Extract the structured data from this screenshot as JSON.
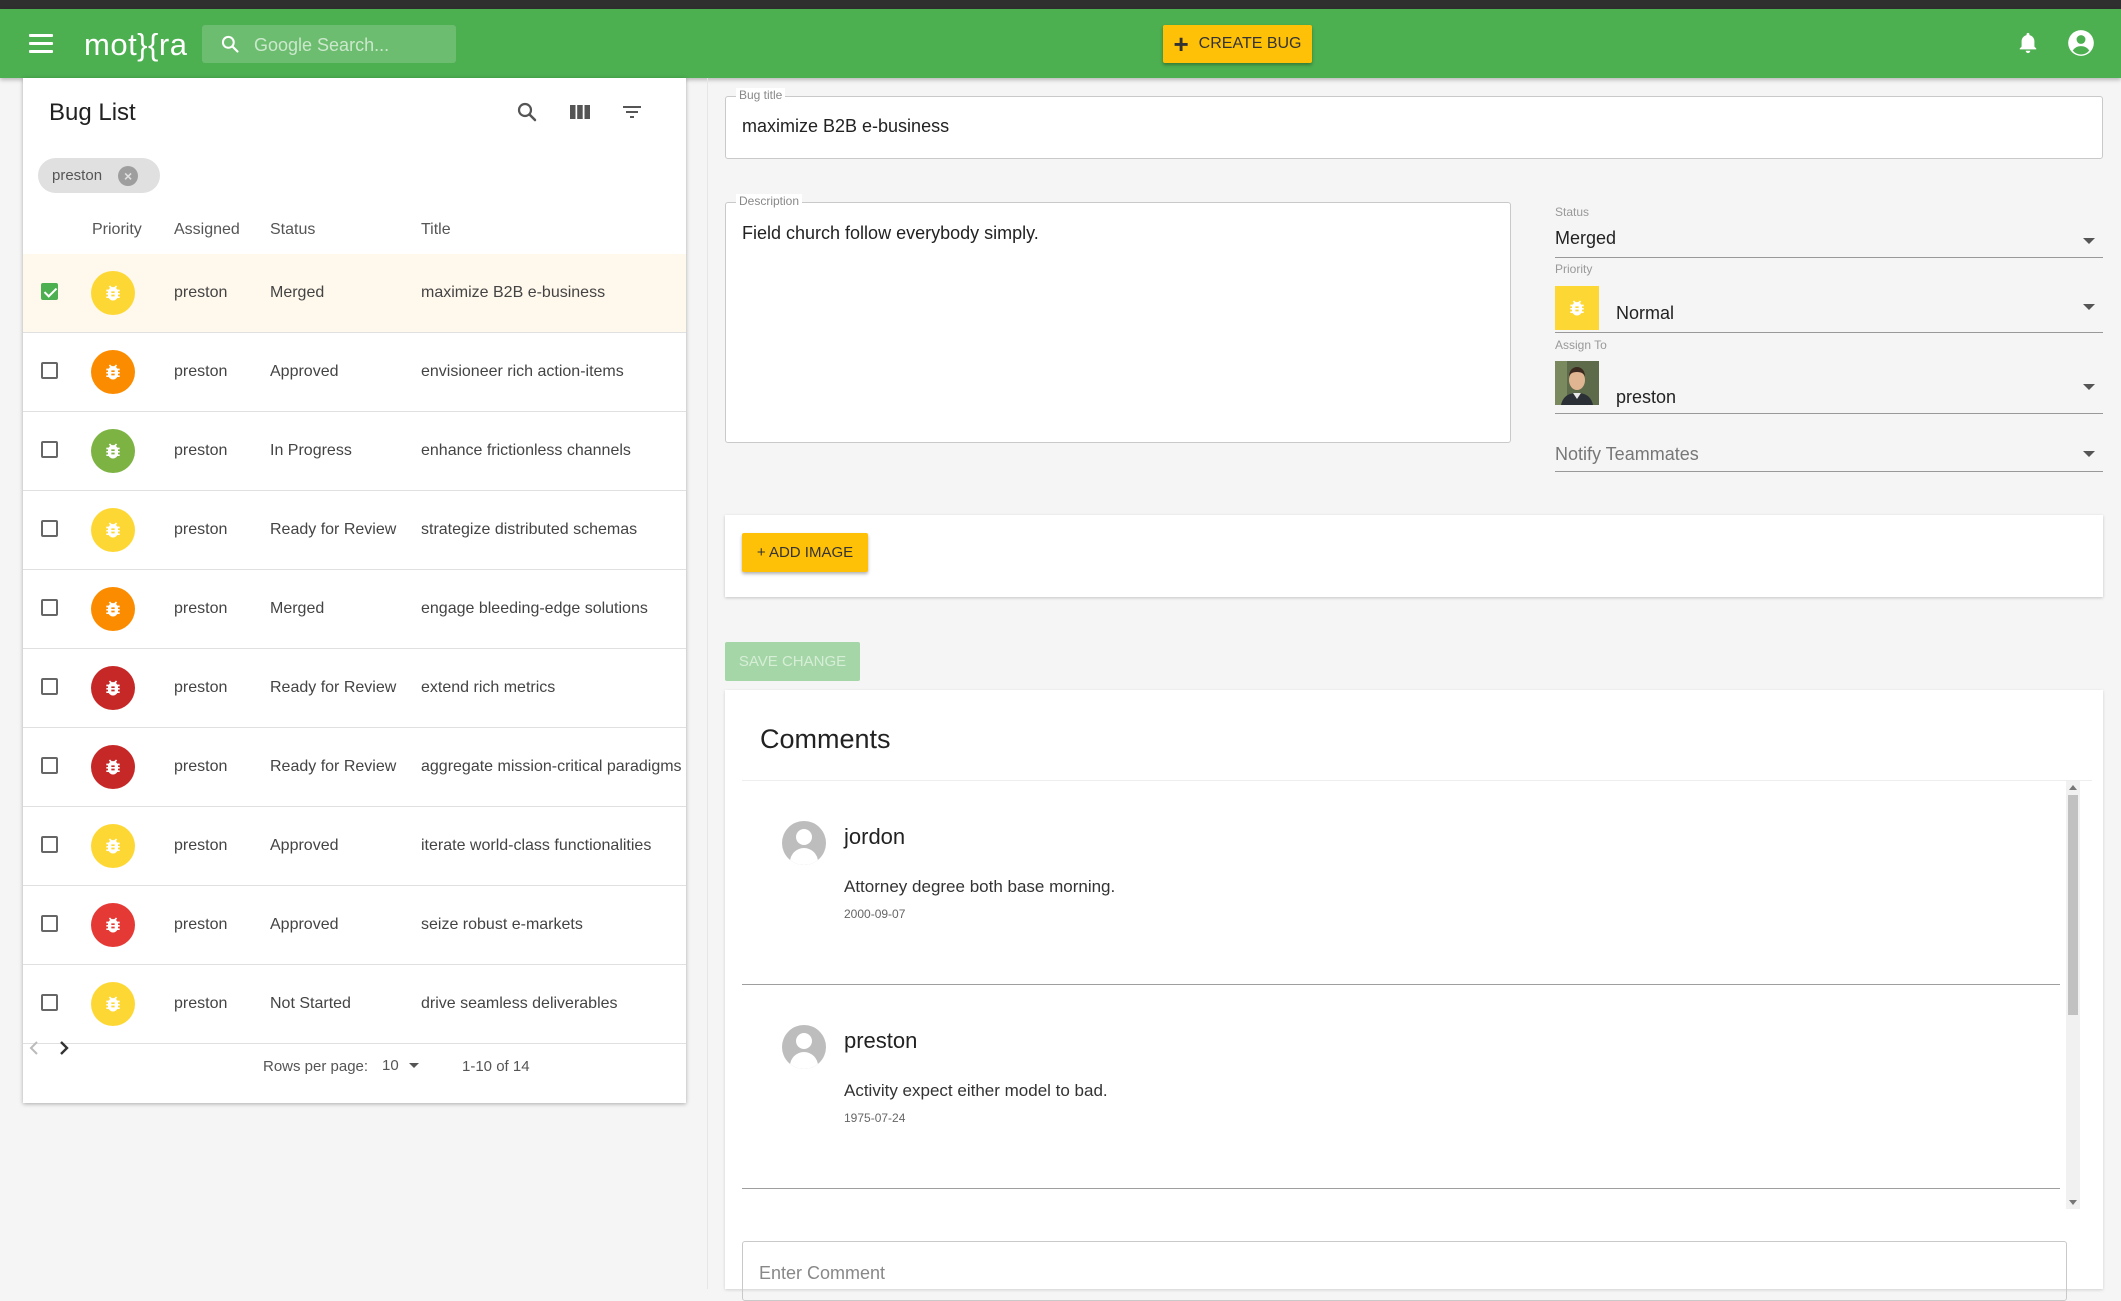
{
  "app": {
    "brand": "mot}{ra",
    "search_placeholder": "Google Search...",
    "create_bug_label": "CREATE BUG"
  },
  "colors": {
    "appbar": "#4caf50",
    "accent": "#ffc107",
    "priority_critical": "#c62828",
    "priority_high": "#e53935",
    "priority_medium": "#fb8c00",
    "priority_normal": "#fdd835",
    "priority_low": "#7cb342"
  },
  "bug_list": {
    "title": "Bug List",
    "filter_chip": "preston",
    "columns": [
      "Priority",
      "Assigned",
      "Status",
      "Title"
    ],
    "rows": [
      {
        "priority_color": "#fdd835",
        "assigned": "preston",
        "status": "Merged",
        "title": "maximize B2B e-business",
        "selected": true
      },
      {
        "priority_color": "#fb8c00",
        "assigned": "preston",
        "status": "Approved",
        "title": "envisioneer rich action-items",
        "selected": false
      },
      {
        "priority_color": "#7cb342",
        "assigned": "preston",
        "status": "In Progress",
        "title": "enhance frictionless channels",
        "selected": false
      },
      {
        "priority_color": "#fdd835",
        "assigned": "preston",
        "status": "Ready for Review",
        "title": "strategize distributed schemas",
        "selected": false
      },
      {
        "priority_color": "#fb8c00",
        "assigned": "preston",
        "status": "Merged",
        "title": "engage bleeding-edge solutions",
        "selected": false
      },
      {
        "priority_color": "#c62828",
        "assigned": "preston",
        "status": "Ready for Review",
        "title": "extend rich metrics",
        "selected": false
      },
      {
        "priority_color": "#c62828",
        "assigned": "preston",
        "status": "Ready for Review",
        "title": "aggregate mission-critical paradigms",
        "selected": false
      },
      {
        "priority_color": "#fdd835",
        "assigned": "preston",
        "status": "Approved",
        "title": "iterate world-class functionalities",
        "selected": false
      },
      {
        "priority_color": "#e53935",
        "assigned": "preston",
        "status": "Approved",
        "title": "seize robust e-markets",
        "selected": false
      },
      {
        "priority_color": "#fdd835",
        "assigned": "preston",
        "status": "Not Started",
        "title": "drive seamless deliverables",
        "selected": false
      }
    ],
    "rows_per_page_label": "Rows per page:",
    "rows_per_page_value": "10",
    "range_label": "1-10 of 14"
  },
  "bug_detail": {
    "title_label": "Bug title",
    "title_value": "maximize B2B e-business",
    "description_label": "Description",
    "description_value": "Field church follow everybody simply.",
    "status_label": "Status",
    "status_value": "Merged",
    "priority_label": "Priority",
    "priority_value": "Normal",
    "assign_label": "Assign To",
    "assign_value": "preston",
    "notify_placeholder": "Notify Teammates",
    "add_image_label": "+ ADD IMAGE",
    "save_label": "SAVE CHANGE"
  },
  "comments": {
    "title": "Comments",
    "items": [
      {
        "author": "jordon",
        "text": "Attorney degree both base morning.",
        "date": "2000-09-07"
      },
      {
        "author": "preston",
        "text": "Activity expect either model to bad.",
        "date": "1975-07-24"
      }
    ],
    "input_placeholder": "Enter Comment"
  }
}
